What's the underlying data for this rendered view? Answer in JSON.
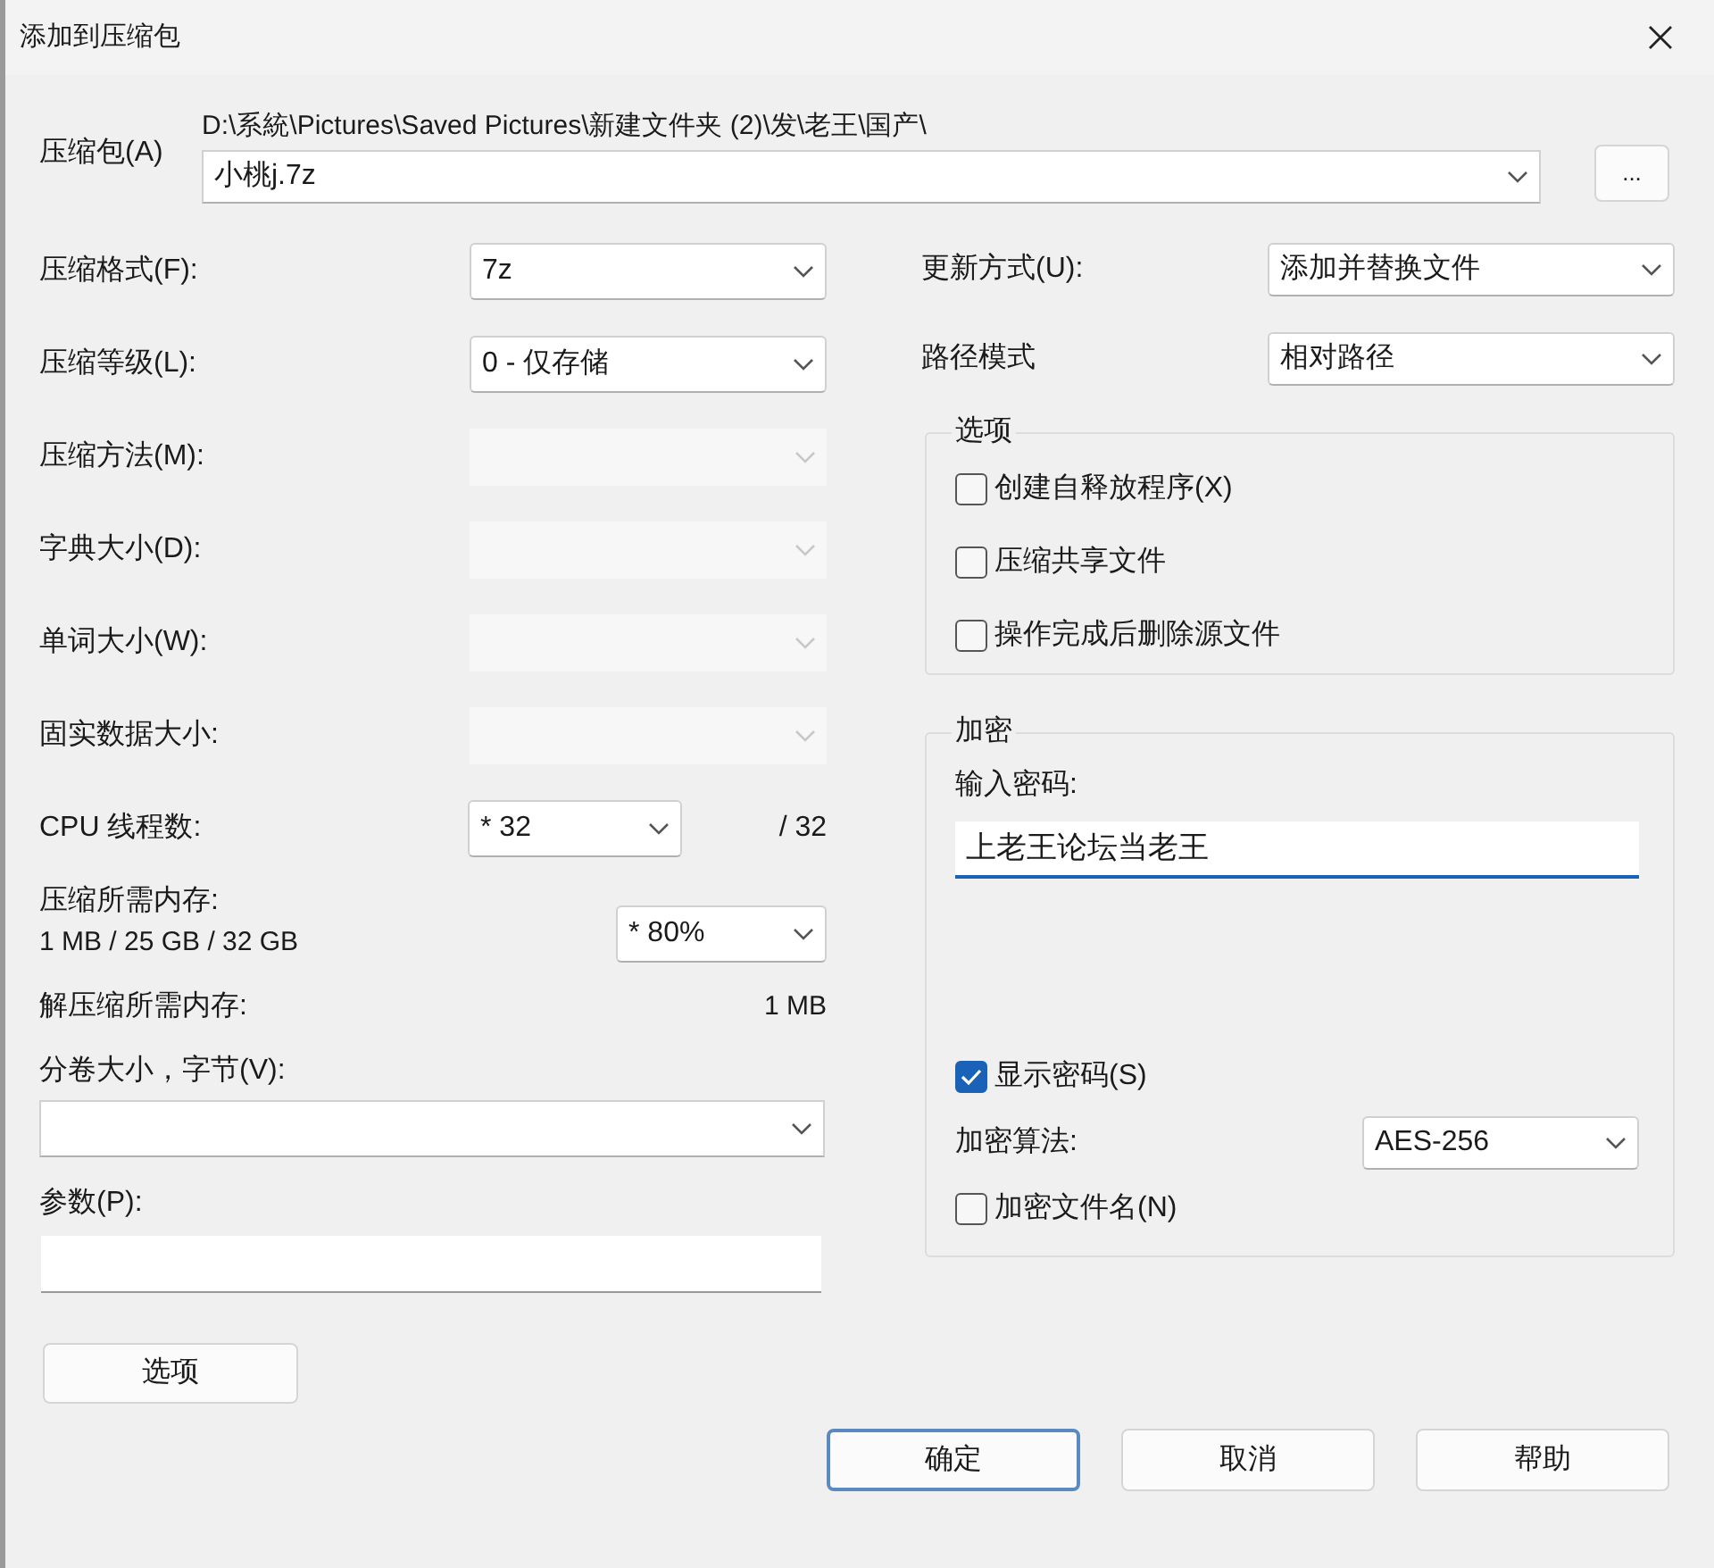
{
  "window": {
    "title": "添加到压缩包"
  },
  "archive": {
    "label": "压缩包(A)",
    "path": "D:\\系統\\Pictures\\Saved Pictures\\新建文件夹 (2)\\发\\老王\\国产\\",
    "value": "小桃j.7z",
    "browse": "..."
  },
  "left_settings": [
    {
      "kind": "select",
      "label": "压缩格式(F):",
      "value": "7z",
      "disabled": false
    },
    {
      "kind": "select",
      "label": "压缩等级(L):",
      "value": "0 - 仅存储",
      "disabled": false
    },
    {
      "kind": "select",
      "label": "压缩方法(M):",
      "disabled": true
    },
    {
      "kind": "select",
      "label": "字典大小(D):",
      "disabled": true
    },
    {
      "kind": "select",
      "label": "单词大小(W):",
      "disabled": true
    },
    {
      "kind": "select",
      "label": "固实数据大小:",
      "disabled": true
    },
    {
      "kind": "threads",
      "label": "CPU 线程数:",
      "value": "* 32",
      "suffix": "/ 32",
      "disabled": false
    },
    {
      "kind": "memory",
      "label": "压缩所需内存:",
      "detail": "1 MB / 25 GB / 32 GB",
      "value": "* 80%",
      "disabled": false
    },
    {
      "kind": "info",
      "label": "解压缩所需内存:",
      "value": "1 MB"
    }
  ],
  "volume": {
    "label": "分卷大小，字节(V):"
  },
  "parameters": {
    "label": "参数(P):"
  },
  "options_button": "选项",
  "right_settings": [
    {
      "label": "更新方式(U):",
      "value": "添加并替换文件"
    },
    {
      "label": "路径模式",
      "value": "相对路径"
    }
  ],
  "options_group": {
    "title": "选项",
    "items": [
      {
        "label": "创建自释放程序(X)",
        "checked": false
      },
      {
        "label": "压缩共享文件",
        "checked": false
      },
      {
        "label": "操作完成后删除源文件",
        "checked": false
      }
    ]
  },
  "encryption": {
    "title": "加密",
    "password_label": "输入密码:",
    "password": "上老王论坛当老王",
    "show_password": {
      "label": "显示密码(S)",
      "checked": true
    },
    "method_label": "加密算法:",
    "method": "AES-256",
    "encrypt_names": {
      "label": "加密文件名(N)",
      "checked": false
    }
  },
  "buttons": [
    {
      "label": "确定",
      "default": true
    },
    {
      "label": "取消",
      "default": false
    },
    {
      "label": "帮助",
      "default": false
    }
  ]
}
